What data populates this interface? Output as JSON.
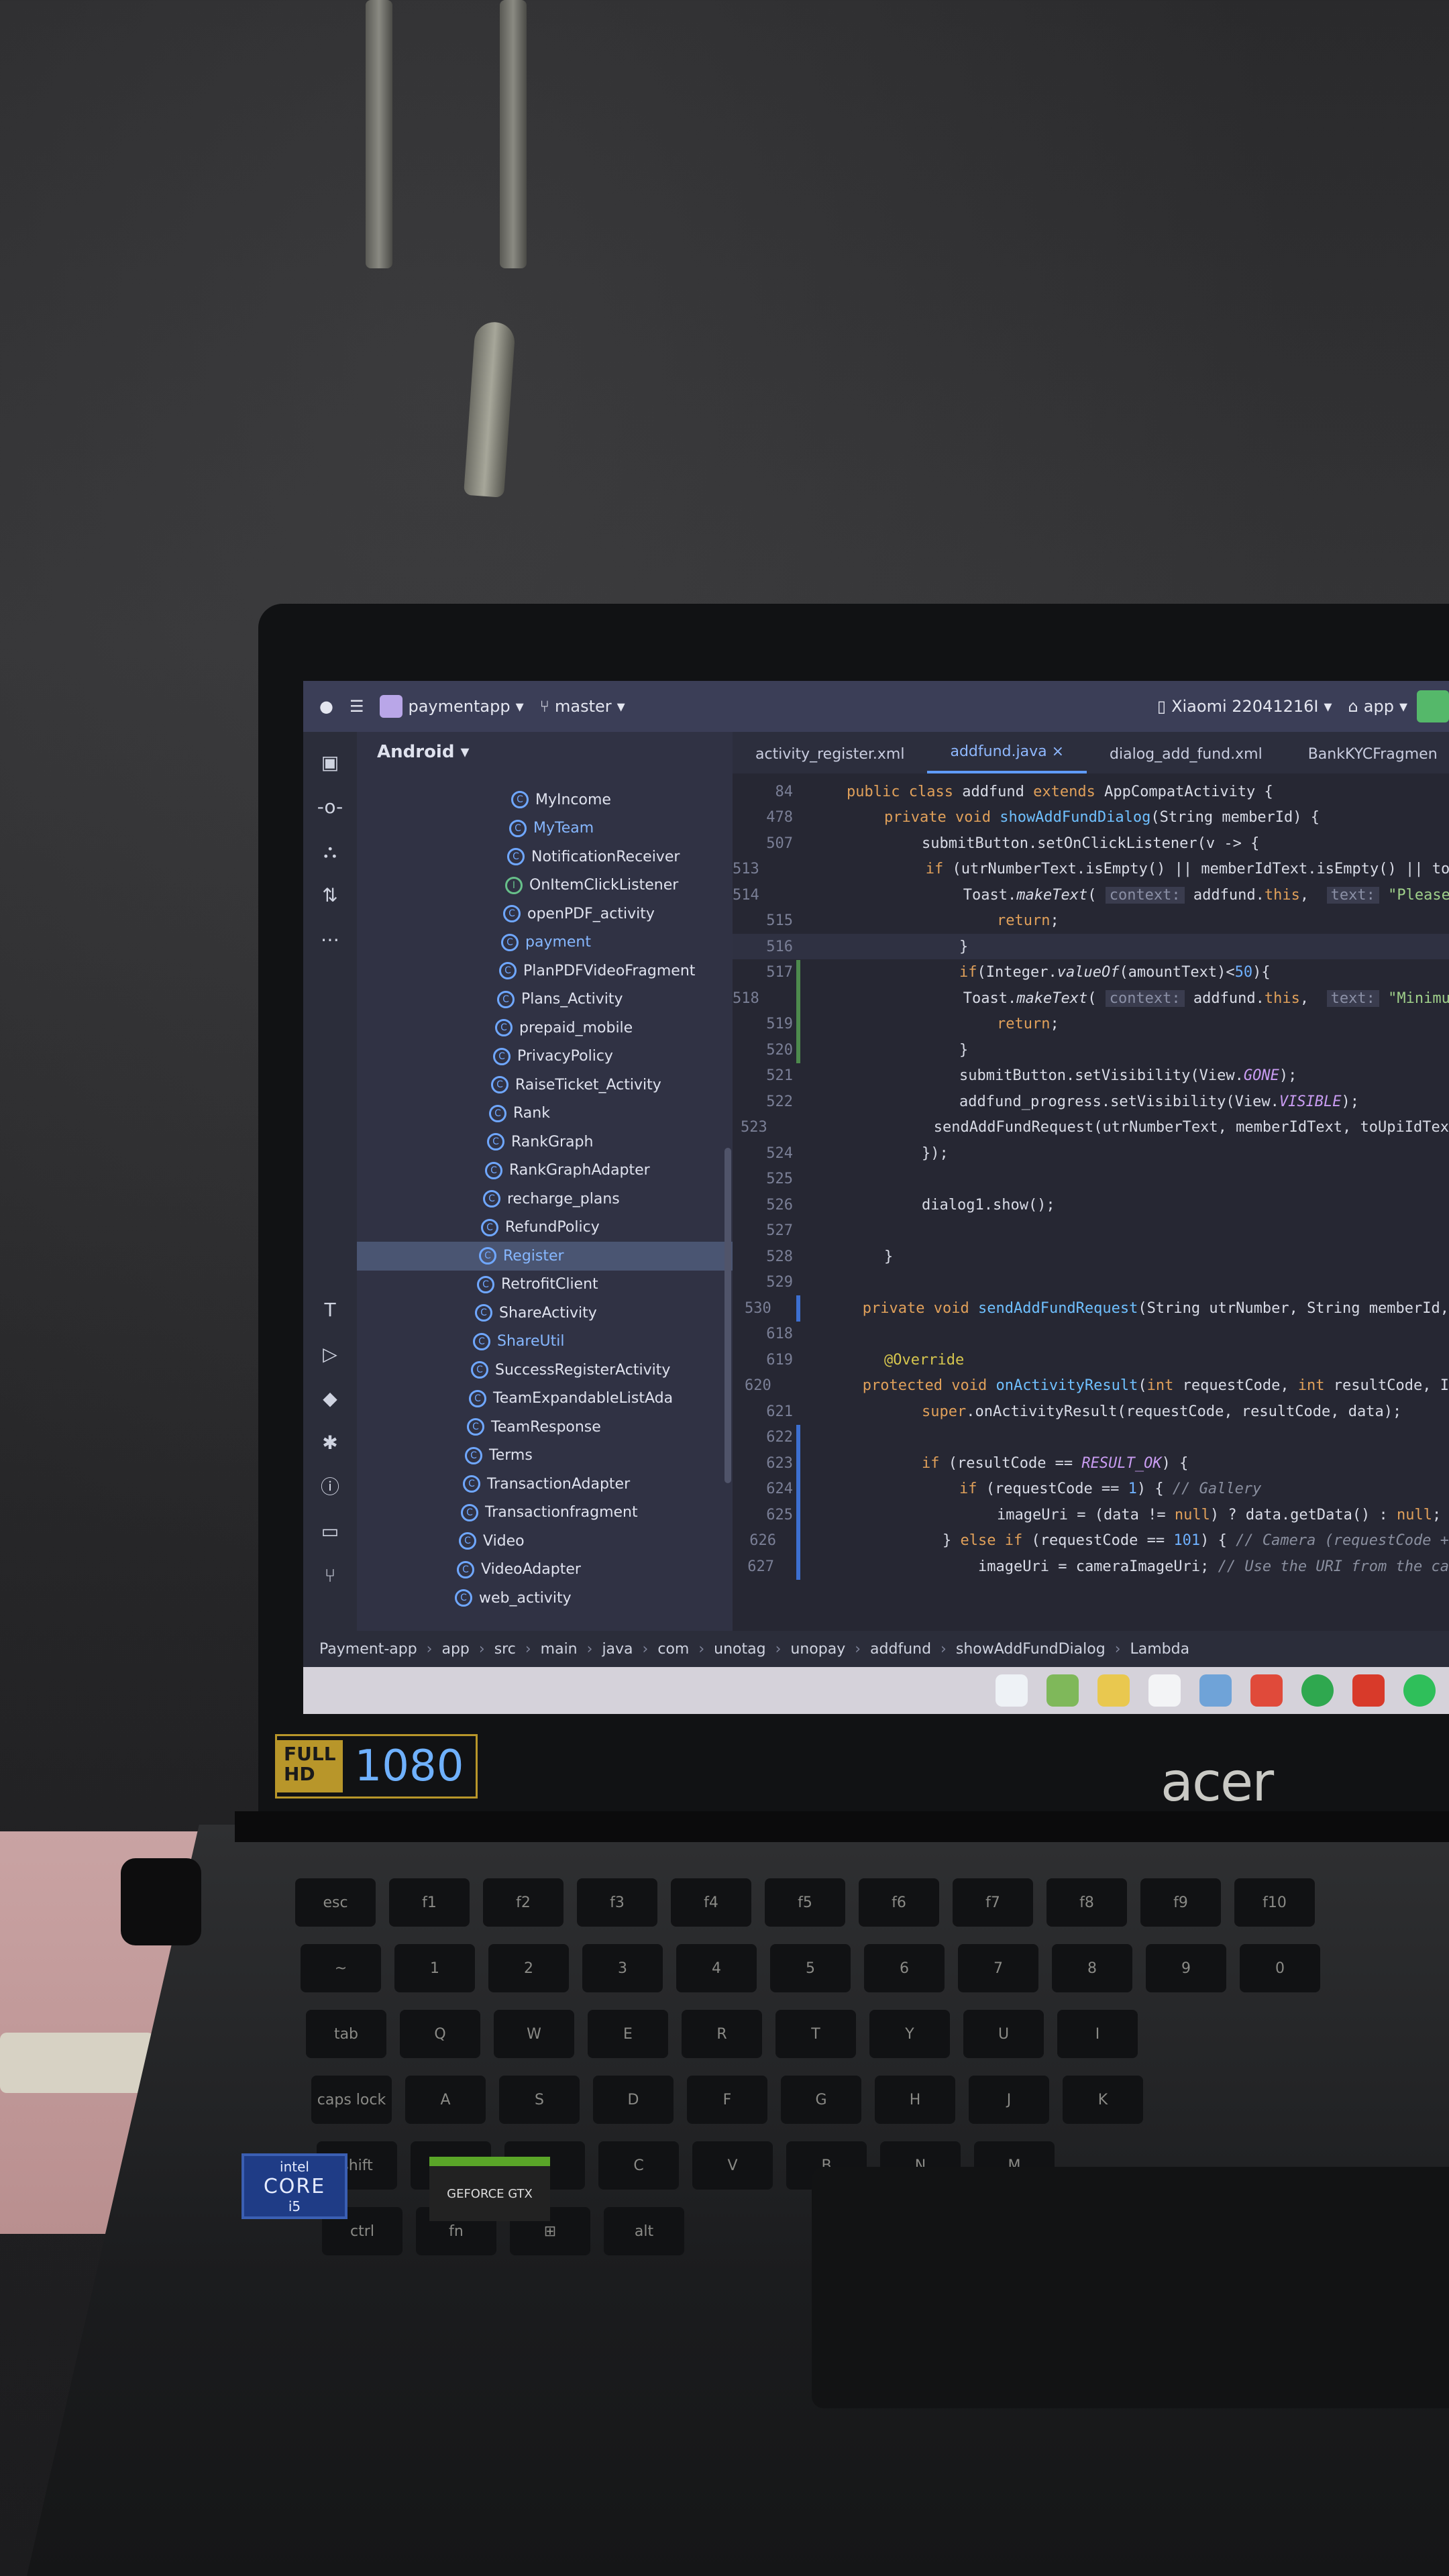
{
  "ide": {
    "project_name": "paymentapp",
    "branch": "master",
    "device": "Xiaomi 22041216I",
    "run_config": "app",
    "project_view": "Android"
  },
  "project_tree": [
    {
      "label": "MyIncome",
      "kind": "class",
      "hl": false
    },
    {
      "label": "MyTeam",
      "kind": "class",
      "hl": true
    },
    {
      "label": "NotificationReceiver",
      "kind": "class",
      "hl": false
    },
    {
      "label": "OnItemClickListener",
      "kind": "interface",
      "hl": false
    },
    {
      "label": "openPDF_activity",
      "kind": "class",
      "hl": false
    },
    {
      "label": "payment",
      "kind": "class",
      "hl": true
    },
    {
      "label": "PlanPDFVideoFragment",
      "kind": "class",
      "hl": false
    },
    {
      "label": "Plans_Activity",
      "kind": "class",
      "hl": false
    },
    {
      "label": "prepaid_mobile",
      "kind": "class",
      "hl": false
    },
    {
      "label": "PrivacyPolicy",
      "kind": "class",
      "hl": false
    },
    {
      "label": "RaiseTicket_Activity",
      "kind": "class",
      "hl": false
    },
    {
      "label": "Rank",
      "kind": "class",
      "hl": false
    },
    {
      "label": "RankGraph",
      "kind": "class",
      "hl": false
    },
    {
      "label": "RankGraphAdapter",
      "kind": "class",
      "hl": false
    },
    {
      "label": "recharge_plans",
      "kind": "class",
      "hl": false
    },
    {
      "label": "RefundPolicy",
      "kind": "class",
      "hl": false
    },
    {
      "label": "Register",
      "kind": "class",
      "hl": true,
      "selected": true
    },
    {
      "label": "RetrofitClient",
      "kind": "class",
      "hl": false
    },
    {
      "label": "ShareActivity",
      "kind": "class",
      "hl": false
    },
    {
      "label": "ShareUtil",
      "kind": "class",
      "hl": true
    },
    {
      "label": "SuccessRegisterActivity",
      "kind": "class",
      "hl": false
    },
    {
      "label": "TeamExpandableListAda",
      "kind": "class",
      "hl": false
    },
    {
      "label": "TeamResponse",
      "kind": "class",
      "hl": false
    },
    {
      "label": "Terms",
      "kind": "class",
      "hl": false
    },
    {
      "label": "TransactionAdapter",
      "kind": "class",
      "hl": false
    },
    {
      "label": "Transactionfragment",
      "kind": "class",
      "hl": false
    },
    {
      "label": "Video",
      "kind": "class",
      "hl": false
    },
    {
      "label": "VideoAdapter",
      "kind": "class",
      "hl": false
    },
    {
      "label": "web_activity",
      "kind": "class",
      "hl": false
    }
  ],
  "tabs": [
    {
      "label": "activity_register.xml",
      "active": false
    },
    {
      "label": "addfund.java",
      "active": true,
      "close": "×"
    },
    {
      "label": "dialog_add_fund.xml",
      "active": false
    },
    {
      "label": "BankKYCFragmen",
      "active": false
    }
  ],
  "code_lines": [
    {
      "n": "84",
      "html": "<span class='kw'>public class</span> addfund <span class='kw'>extends</span> AppCompatActivity {",
      "indent": 0
    },
    {
      "n": "478",
      "html": "<span class='kw'>private void</span> <span class='fn'>showAddFundDialog</span>(String memberId) {",
      "indent": 1
    },
    {
      "n": "507",
      "html": "submitButton.setOnClickListener(v -&gt; {",
      "indent": 2
    },
    {
      "n": "513",
      "html": "<span class='kw'>if</span> (utrNumberText.isEmpty() || memberIdText.isEmpty() || to",
      "indent": 3
    },
    {
      "n": "514",
      "html": "Toast.<i>makeText</i>( <span class='hint'>context:</span> addfund.<span class='kw'>this</span>,  <span class='hint'>text:</span> <span class='str'>\"Please fill</span>",
      "indent": 4
    },
    {
      "n": "515",
      "html": "<span class='kw'>return</span>;",
      "indent": 4
    },
    {
      "n": "516",
      "html": "}",
      "indent": 3,
      "current": true
    },
    {
      "n": "517",
      "html": "<span class='kw'>if</span>(Integer.<i>valueOf</i>(amountText)&lt;<span class='num'>50</span>){",
      "indent": 3
    },
    {
      "n": "518",
      "html": "Toast.<i>makeText</i>( <span class='hint'>context:</span> addfund.<span class='kw'>this</span>,  <span class='hint'>text:</span> <span class='str'>\"Minimum amou</span>",
      "indent": 4
    },
    {
      "n": "519",
      "html": "<span class='kw'>return</span>;",
      "indent": 4
    },
    {
      "n": "520",
      "html": "}",
      "indent": 3
    },
    {
      "n": "521",
      "html": "submitButton.setVisibility(View.<span class='const'>GONE</span>);",
      "indent": 3
    },
    {
      "n": "522",
      "html": "addfund_progress.setVisibility(View.<span class='const'>VISIBLE</span>);",
      "indent": 3
    },
    {
      "n": "523",
      "html": "sendAddFundRequest(utrNumberText, memberIdText, toUpiIdTex",
      "indent": 3
    },
    {
      "n": "524",
      "html": "});",
      "indent": 2
    },
    {
      "n": "525",
      "html": "",
      "indent": 0
    },
    {
      "n": "526",
      "html": "dialog1.show();",
      "indent": 2
    },
    {
      "n": "527",
      "html": "",
      "indent": 0
    },
    {
      "n": "528",
      "html": "}",
      "indent": 1
    },
    {
      "n": "529",
      "html": "",
      "indent": 0
    },
    {
      "n": "530",
      "html": "<span class='kw'>private void</span> <span class='fn'>sendAddFundRequest</span>(String utrNumber, String memberId,",
      "indent": 1
    },
    {
      "n": "618",
      "html": "",
      "indent": 0
    },
    {
      "n": "619",
      "html": "<span class='ann'>@Override</span>",
      "indent": 1
    },
    {
      "n": "620",
      "html": "<span class='kw'>protected void</span> <span class='fn'>onActivityResult</span>(<span class='kw'>int</span> requestCode, <span class='kw'>int</span> resultCode, I",
      "indent": 1
    },
    {
      "n": "621",
      "html": "<span class='kw'>super</span>.onActivityResult(requestCode, resultCode, data);",
      "indent": 2
    },
    {
      "n": "622",
      "html": "",
      "indent": 0
    },
    {
      "n": "623",
      "html": "<span class='kw'>if</span> (resultCode == <span class='const'>RESULT_OK</span>) {",
      "indent": 2
    },
    {
      "n": "624",
      "html": "<span class='kw'>if</span> (requestCode == <span class='num'>1</span>) { <span class='cmt'>// Gallery</span>",
      "indent": 3
    },
    {
      "n": "625",
      "html": "imageUri = (data != <span class='kw'>null</span>) ? data.getData() : <span class='kw'>null</span>;",
      "indent": 4
    },
    {
      "n": "626",
      "html": "} <span class='kw'>else if</span> (requestCode == <span class='num'>101</span>) { <span class='cmt'>// Camera (requestCode +</span>",
      "indent": 3
    },
    {
      "n": "627",
      "html": "imageUri = cameraImageUri; <span class='cmt'>// Use the URI from the ca</span>",
      "indent": 4
    }
  ],
  "breadcrumb": [
    "Payment-app",
    "app",
    "src",
    "main",
    "java",
    "com",
    "unotag",
    "unopay",
    "addfund",
    "showAddFundDialog",
    "Lambda"
  ],
  "laptop": {
    "brand": "acer",
    "display_badge_full": "FULL",
    "display_badge_hd": "HD",
    "display_badge_res": "1080",
    "sticker_intel_brand": "intel",
    "sticker_intel_core": "CORE",
    "sticker_intel_tier": "i5",
    "sticker_gpu": "GEFORCE GTX"
  },
  "keyboard_rows": [
    [
      "esc",
      "f1",
      "f2",
      "f3",
      "f4",
      "f5",
      "f6",
      "f7",
      "f8",
      "f9",
      "f10"
    ],
    [
      "~",
      "1",
      "2",
      "3",
      "4",
      "5",
      "6",
      "7",
      "8",
      "9",
      "0"
    ],
    [
      "tab",
      "Q",
      "W",
      "E",
      "R",
      "T",
      "Y",
      "U",
      "I"
    ],
    [
      "caps lock",
      "A",
      "S",
      "D",
      "F",
      "G",
      "H",
      "J",
      "K"
    ],
    [
      "shift",
      "Z",
      "X",
      "C",
      "V",
      "B",
      "N",
      "M"
    ],
    [
      "ctrl",
      "fn",
      "⊞",
      "alt"
    ]
  ],
  "colors": {
    "ide_titlebar": "#3b3e57",
    "editor_bg": "#262733",
    "accent": "#5f9bff"
  }
}
